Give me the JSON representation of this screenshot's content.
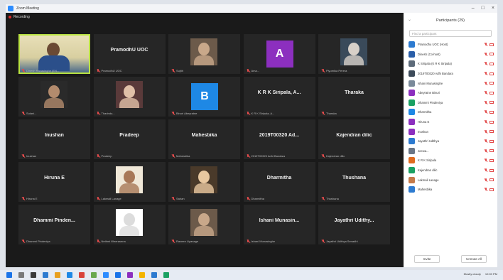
{
  "window": {
    "title": "Zoom Meeting"
  },
  "meeting": {
    "recording_label": "Recording",
    "tiles": [
      {
        "kind": "video",
        "label": "Dinesh Ranasinghe (EN...",
        "active": true
      },
      {
        "kind": "name",
        "name": "PramodhU UOC",
        "label": "PramodhU UOC"
      },
      {
        "kind": "photo",
        "label": "Sujith"
      },
      {
        "kind": "letter",
        "letter": "A",
        "color": "#8c2fbf",
        "label": "Ama..."
      },
      {
        "kind": "photo",
        "label": "Piyumika Perera"
      },
      {
        "kind": "photo",
        "label": "Sulani..."
      },
      {
        "kind": "photo",
        "label": "Tharindu..."
      },
      {
        "kind": "letter",
        "letter": "B",
        "color": "#1e88e5",
        "label": "Binuri Abeyratne"
      },
      {
        "kind": "name",
        "name": "K R K Siripala, A...",
        "label": "K R K Siripala, A..."
      },
      {
        "kind": "name",
        "name": "Tharaka",
        "label": "Tharaka"
      },
      {
        "kind": "name",
        "name": "Inushan",
        "label": "Inushan"
      },
      {
        "kind": "name",
        "name": "Pradeep",
        "label": "Pradeep"
      },
      {
        "kind": "name",
        "name": "Mahesbika",
        "label": "Mahesbika"
      },
      {
        "kind": "name",
        "name": "2019T00320 Ad...",
        "label": "2019T00320 Adhi Bandara"
      },
      {
        "kind": "name",
        "name": "Kajendran dilic",
        "label": "Kajendran dilic"
      },
      {
        "kind": "name",
        "name": "Hiruna E",
        "label": "Hiruna E"
      },
      {
        "kind": "photo",
        "label": "Lakmali Lanage"
      },
      {
        "kind": "photo",
        "label": "Sahan"
      },
      {
        "kind": "name",
        "name": "Dharmitha",
        "label": "Dharmitha"
      },
      {
        "kind": "name",
        "name": "Thushana",
        "label": "Thushana"
      },
      {
        "kind": "name",
        "name": "Dhammi Pinden...",
        "label": "Dhammi Pindeniya"
      },
      {
        "kind": "photo",
        "label": "Nethmi Weerasena"
      },
      {
        "kind": "photo",
        "label": "Raveen Liyanage"
      },
      {
        "kind": "name",
        "name": "Ishani Munasin...",
        "label": "Ishani Munasinghe"
      },
      {
        "kind": "name",
        "name": "Jayathri Udithy...",
        "label": "Jayathri Udithya Senadhi"
      }
    ]
  },
  "panel": {
    "title": "Participants (29)",
    "search_placeholder": "Find a participant",
    "participants": [
      {
        "name": "Pramodhu UOC (Host)",
        "color": "#2d7bd0"
      },
      {
        "name": "Dinesh (Co-host)",
        "color": "#2a5ea8"
      },
      {
        "name": "K Siripala (K R K Siripala)",
        "color": "#5d6b7a"
      },
      {
        "name": "2019T00320 Adhi Bandara",
        "color": "#3d4b5a"
      },
      {
        "name": "Ishani Munasinghe",
        "color": "#7a8a9a"
      },
      {
        "name": "Abeyratne Binuri",
        "color": "#8c2fbf"
      },
      {
        "name": "Dhammi Pindeniya",
        "color": "#1aa163"
      },
      {
        "name": "Dharmitha",
        "color": "#1e88e5"
      },
      {
        "name": "Hiruna E",
        "color": "#8c2fbf"
      },
      {
        "name": "Inushan",
        "color": "#8c2fbf"
      },
      {
        "name": "Jayathri Udithya",
        "color": "#2d7bd0"
      },
      {
        "name": "Jeewa...",
        "color": "#6a7686"
      },
      {
        "name": "K R K Siripala",
        "color": "#e06b1f"
      },
      {
        "name": "Kajendran dilic",
        "color": "#1aa163"
      },
      {
        "name": "Lakmali Lanage",
        "color": "#c47a4a"
      },
      {
        "name": "Mahesbika",
        "color": "#2d7bd0"
      }
    ],
    "invite_label": "Invite",
    "unmute_label": "Unmute All"
  },
  "taskbar": {
    "apps": [
      "#1a73e8",
      "#7a7a7a",
      "#3a3a3a",
      "#2d7bd0",
      "#e8a020",
      "#1e88e5",
      "#d9443b",
      "#6aa84f",
      "#2d8cff",
      "#1a73e8",
      "#8c2fbf",
      "#f4b400",
      "#2d7bd0",
      "#1aa163"
    ],
    "tray_text": "Mostly cloudy",
    "clock": "10:00 PM"
  }
}
